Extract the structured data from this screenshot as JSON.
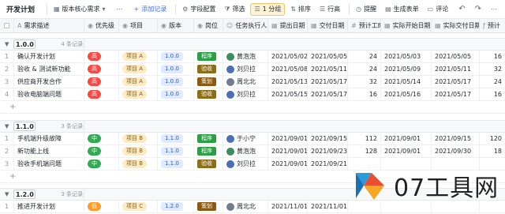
{
  "toolbar": {
    "title": "开发计划",
    "view_name": "版本核心需求",
    "add_record": "添加记录",
    "field_config": "字段配置",
    "filter": "筛选",
    "group": "1 分组",
    "sort": "排序",
    "row_height": "行高",
    "remind": "提醒",
    "gen_form": "生成表单",
    "comment": "评论"
  },
  "columns": [
    "需求描述",
    "优先级",
    "项目",
    "版本",
    "岗位",
    "任务执行人",
    "提出日期",
    "交付日期",
    "预计工时",
    "实际开始日期",
    "实际交付日期",
    "预计"
  ],
  "groups": [
    {
      "label": "1.0.0",
      "count": "4 条记录",
      "rows": [
        {
          "n": "1",
          "desc": "确认开发计划",
          "pri": "高",
          "proj": "项目 A",
          "ver": "1.0.0",
          "pos": "程序",
          "person": "黄泡泡",
          "d1": "2021/05/02",
          "d2": "2021/05/05",
          "hrs": "24",
          "d3": "2021/05/03",
          "d4": "2021/05/05",
          "est": "16"
        },
        {
          "n": "2",
          "desc": "验收 & 测试新功能",
          "pri": "高",
          "proj": "项目 A",
          "ver": "1.0.0",
          "pos": "验收",
          "person": "刘贝拉",
          "d1": "2021/05/08",
          "d2": "2021/05/11",
          "hrs": "24",
          "d3": "2021/05/09",
          "d4": "2021/05/11",
          "est": "32"
        },
        {
          "n": "3",
          "desc": "供应商开发合作",
          "pri": "高",
          "proj": "项目 A",
          "ver": "1.0.0",
          "pos": "策划",
          "person": "周北北",
          "d1": "2021/05/13",
          "d2": "2021/05/17",
          "hrs": "32",
          "d3": "2021/05/14",
          "d4": "2021/05/17",
          "est": "24"
        },
        {
          "n": "4",
          "desc": "验收电脑端问题",
          "pri": "高",
          "proj": "项目 A",
          "ver": "1.0.0",
          "pos": "验收",
          "person": "刘贝拉",
          "d1": "2021/05/15",
          "d2": "2021/05/17",
          "hrs": "16",
          "d3": "2021/05/16",
          "d4": "2021/05/17",
          "est": "16"
        }
      ]
    },
    {
      "label": "1.1.0",
      "count": "3 条记录",
      "rows": [
        {
          "n": "1",
          "desc": "手机端升级故障",
          "pri": "中",
          "proj": "项目 B",
          "ver": "1.1.0",
          "pos": "程序",
          "person": "于小宁",
          "d1": "2021/09/01",
          "d2": "2021/09/15",
          "hrs": "112",
          "d3": "2021/09/01",
          "d4": "2021/09/15",
          "est": "120"
        },
        {
          "n": "2",
          "desc": "新功能上线",
          "pri": "中",
          "proj": "项目 B",
          "ver": "1.1.0",
          "pos": "程序",
          "person": "黄泡泡",
          "d1": "2021/09/01",
          "d2": "2021/09/23",
          "hrs": "128",
          "d3": "2021/09/01",
          "d4": "2021/09/30",
          "est": "18"
        },
        {
          "n": "3",
          "desc": "验收手机端问题",
          "pri": "中",
          "proj": "项目 B",
          "ver": "1.1.0",
          "pos": "验收",
          "person": "刘贝拉",
          "d1": "2021/09/01",
          "d2": "2021/09/21",
          "hrs": "",
          "d3": "",
          "d4": "",
          "est": ""
        }
      ]
    },
    {
      "label": "1.2.0",
      "count": "3 条记录",
      "rows": [
        {
          "n": "1",
          "desc": "推进开发计划",
          "pri": "低",
          "proj": "项目 C",
          "ver": "1.2.0",
          "pos": "策划",
          "person": "周北北",
          "d1": "2021/11/01",
          "d2": "2021/11/01",
          "hrs": "",
          "d3": "",
          "d4": "",
          "est": ""
        }
      ]
    }
  ],
  "watermark": "07工具网",
  "colors": {
    "accent": "#3370ff",
    "pri_high": "#f54a45",
    "pri_mid": "#34a853",
    "pri_low": "#ff9b29"
  }
}
